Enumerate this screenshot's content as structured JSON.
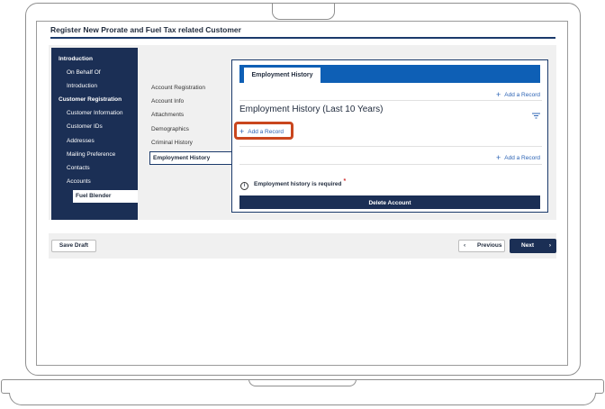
{
  "window": {
    "title": "Register New Prorate and Fuel Tax related Customer"
  },
  "leftnav": {
    "items": [
      {
        "label": "Introduction"
      },
      {
        "label": "On Behalf Of"
      },
      {
        "label": "Introduction"
      },
      {
        "label": "Customer Registration"
      },
      {
        "label": "Customer Information"
      },
      {
        "label": "Customer IDs"
      },
      {
        "label": "Addresses"
      },
      {
        "label": "Mailing Preference"
      },
      {
        "label": "Contacts"
      },
      {
        "label": "Accounts"
      },
      {
        "label": "Fuel Blender"
      }
    ],
    "selected": "Fuel Blender"
  },
  "subnav": {
    "items": [
      {
        "label": "Account Registration"
      },
      {
        "label": "Account Info"
      },
      {
        "label": "Attachments"
      },
      {
        "label": "Demographics"
      },
      {
        "label": "Criminal History"
      },
      {
        "label": "Employment History"
      }
    ],
    "selected": "Employment History"
  },
  "panel": {
    "tab_label": "Employment History",
    "add_record_label": "Add a Record",
    "section_title": "Employment History (Last 10 Years)",
    "info_text": "Employment history is required",
    "required_mark": "*",
    "delete_label": "Delete Account"
  },
  "footer": {
    "save_draft_label": "Save Draft",
    "previous_label": "Previous",
    "next_label": "Next"
  },
  "icons": {
    "plus": "plus-icon",
    "filter": "filter-icon",
    "info": "info-icon",
    "chevron_left": "chevron-left-icon",
    "chevron_right": "chevron-right-icon"
  },
  "colors": {
    "nav_bg": "#1b2f55",
    "accent_blue": "#0e5fb5",
    "link_blue": "#2d64b5",
    "highlight": "#c9461e",
    "required": "#d12f2f"
  }
}
